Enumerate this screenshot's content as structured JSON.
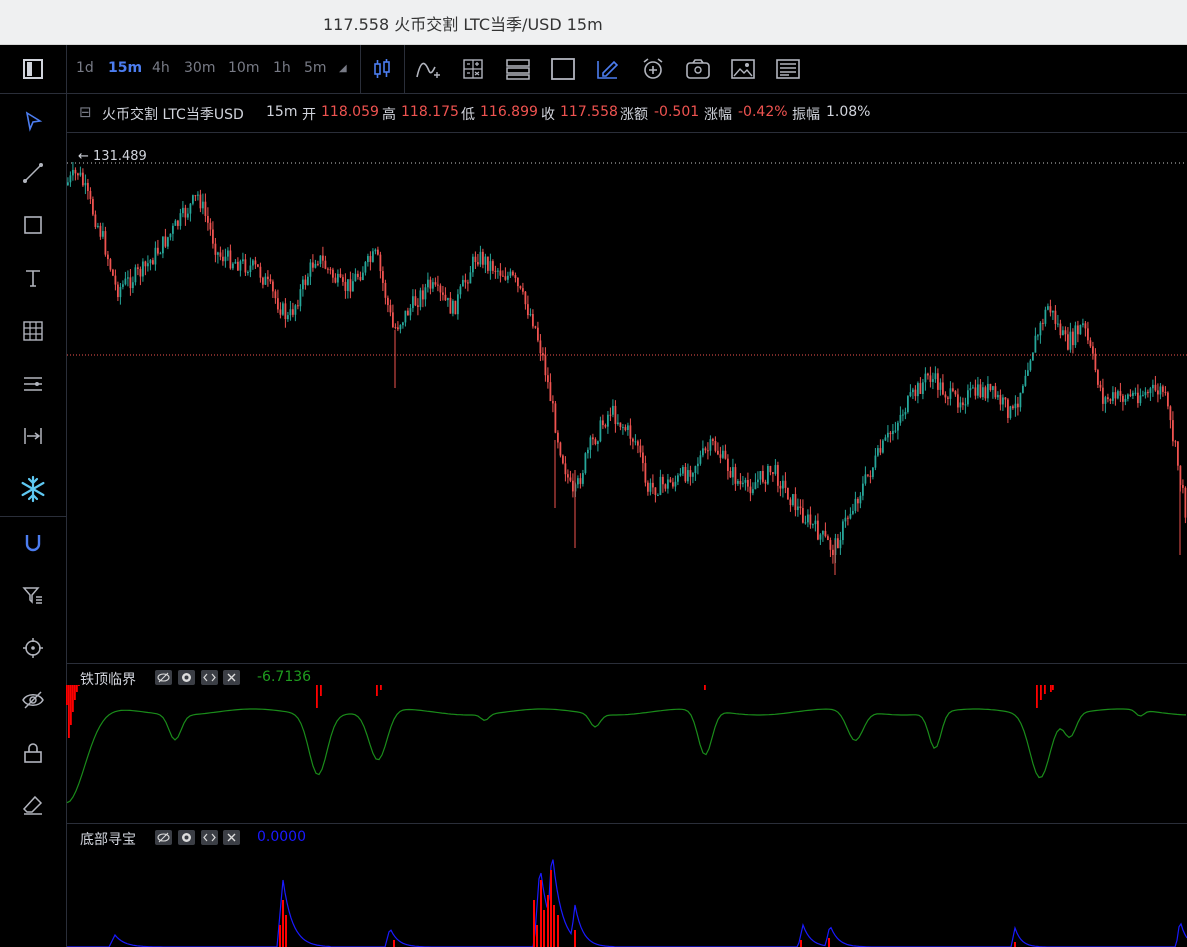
{
  "window": {
    "title": "117.558 火币交割 LTC当季/USD 15m"
  },
  "toolbar": {
    "intervals": [
      "1d",
      "15m",
      "4h",
      "30m",
      "10m",
      "1h",
      "5m"
    ],
    "active_interval": "15m",
    "icons": [
      "candlestick-icon",
      "indicator-icon",
      "calculator-icon",
      "layout-icon",
      "fullscreen-icon",
      "pencil-icon",
      "alarm-icon",
      "camera-icon",
      "image-icon",
      "news-icon"
    ]
  },
  "sidebar": {
    "tools": [
      "panel-toggle-icon",
      "cursor-icon",
      "trendline-icon",
      "rectangle-icon",
      "text-icon",
      "grid-icon",
      "fib-icon",
      "measure-icon",
      "freeze-icon",
      "magnet-icon",
      "filter-icon",
      "target-icon",
      "eye-icon",
      "lock-icon",
      "eraser-icon"
    ]
  },
  "legend": {
    "symbol": "火币交割 LTC当季USD",
    "interval": "15m",
    "open_label": "开",
    "open": "118.059",
    "high_label": "高",
    "high": "118.175",
    "low_label": "低",
    "low": "116.899",
    "close_label": "收",
    "close": "117.558",
    "change_label": "涨额",
    "change": "-0.501",
    "change_pct_label": "涨幅",
    "change_pct": "-0.42%",
    "amplitude_label": "振幅",
    "amplitude": "1.08%"
  },
  "price_marker": {
    "label": "← 131.489"
  },
  "indicators": [
    {
      "name": "铁顶临界",
      "value": "-6.7136",
      "value_color": "#1f9d1f"
    },
    {
      "name": "底部寻宝",
      "value": "0.0000",
      "value_color": "#1a1aff"
    }
  ],
  "colors": {
    "up": "#26a69a",
    "down": "#ef5350",
    "accent": "#4c7df0",
    "indicator_line": "#1a8c1a",
    "bar_red": "#ff0000",
    "bottom_line": "#1a1aff"
  }
}
